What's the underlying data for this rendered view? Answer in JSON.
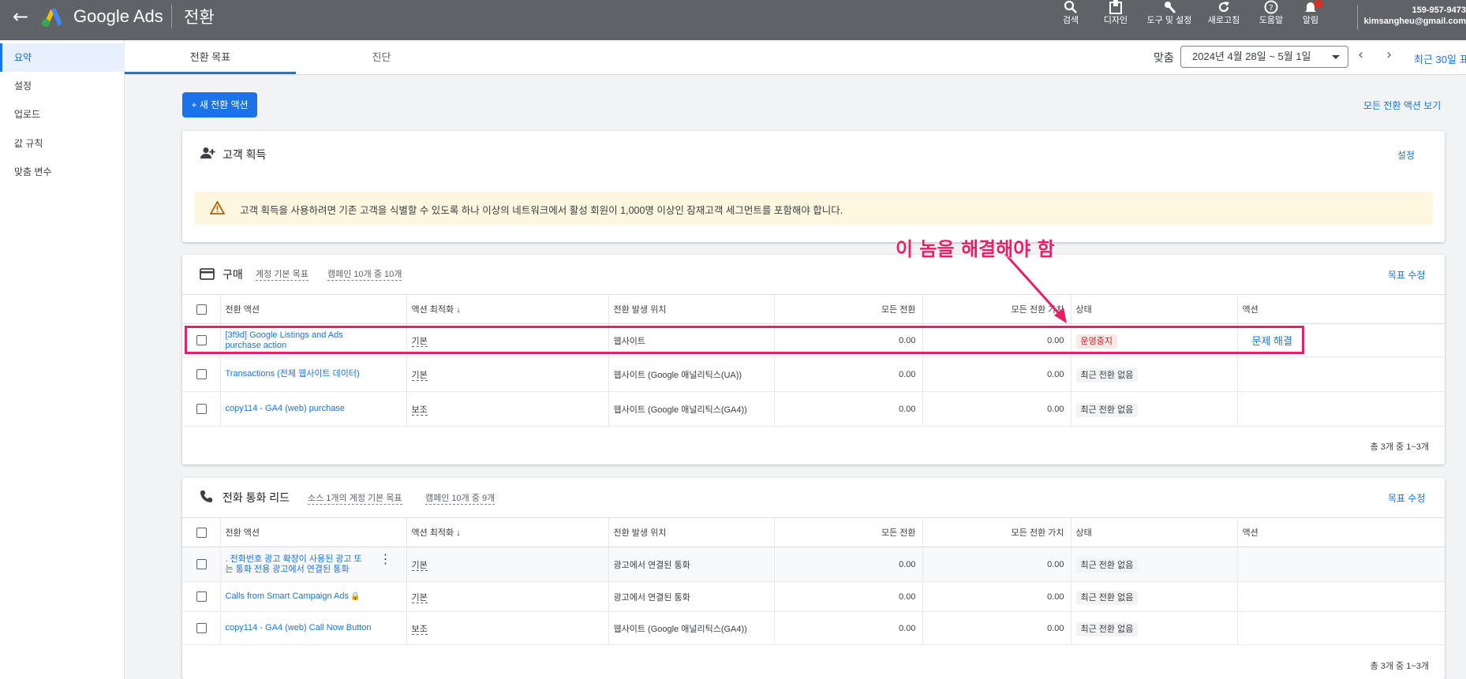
{
  "topbar": {
    "brand": "Google Ads",
    "page_title": "전환",
    "tools": [
      {
        "label": "검색",
        "icon": "search-icon"
      },
      {
        "label": "디자인",
        "icon": "design-icon"
      },
      {
        "label": "도구 및 설정",
        "icon": "wrench-icon"
      },
      {
        "label": "새로고침",
        "icon": "refresh-icon"
      },
      {
        "label": "도움말",
        "icon": "help-icon"
      },
      {
        "label": "알림",
        "icon": "bell-icon"
      }
    ],
    "account_id": "159-957-9473",
    "account_email": "kimsangheu@gmail.com"
  },
  "tabs": {
    "summary": "전환 목표",
    "diagnostics": "진단"
  },
  "date": {
    "label": "맞춤",
    "range": "2024년 4월 28일 ~ 5월 1일",
    "recent": "최근 30일 표"
  },
  "sidebar": {
    "items": [
      {
        "label": "요약",
        "active": true
      },
      {
        "label": "설정"
      },
      {
        "label": "업로드"
      },
      {
        "label": "값 규칙"
      },
      {
        "label": "맞춤 변수"
      }
    ]
  },
  "main": {
    "new_action": "+ 새 전환 액션",
    "view_all": "모든 전환 액션 보기"
  },
  "acquisition": {
    "title": "고객 획득",
    "settings": "설정",
    "warning": "고객 획득을 사용하려면 기존 고객을 식별할 수 있도록 하나 이상의 네트워크에서 활성 회원이 1,000명 이상인 잠재고객 세그먼트를 포함해야 합니다."
  },
  "columns": {
    "action": "전환 액션",
    "optimization": "액션 최적화",
    "source": "전환 발생 위치",
    "all_conv": "모든 전환",
    "all_value": "모든 전환 가치",
    "status": "상태",
    "actions": "액션"
  },
  "purchase": {
    "title": "구매",
    "tag1": "계정 기본 목표",
    "tag2": "캠페인 10개 중 10개",
    "edit": "목표 수정",
    "rows": [
      {
        "name_l1": "[3f9d] Google Listings and Ads",
        "name_l2": "purchase action",
        "opt": "기본",
        "source": "웹사이트",
        "conv": "0.00",
        "value": "0.00",
        "status": "운영중지",
        "action": "문제 해결"
      },
      {
        "name_l1": "Transactions (전체 웹사이트 데이터)",
        "opt": "기본",
        "source": "웹사이트 (Google 애널리틱스(UA))",
        "conv": "0.00",
        "value": "0.00",
        "status": "최근 전환 없음"
      },
      {
        "name_l1": "copy114 - GA4 (web) purchase",
        "opt": "보조",
        "source": "웹사이트 (Google 애널리틱스(GA4))",
        "conv": "0.00",
        "value": "0.00",
        "status": "최근 전환 없음"
      }
    ],
    "footer": "총 3개 중 1~3개"
  },
  "calls": {
    "title": "전화 통화 리드",
    "tag1": "소스 1개의 계정 기본 목표",
    "tag2": "캠페인 10개 중 9개",
    "edit": "목표 수정",
    "rows": [
      {
        "name_l1": ". 전화번호 광고 확장이 사용된 광고 또",
        "name_l2": "는 통화 전용 광고에서 연결된 통화",
        "opt": "기본",
        "source": "광고에서 연결된 통화",
        "conv": "0.00",
        "value": "0.00",
        "status": "최근 전환 없음"
      },
      {
        "name_l1": "Calls from Smart Campaign Ads",
        "opt": "기본",
        "source": "광고에서 연결된 통화",
        "conv": "0.00",
        "value": "0.00",
        "status": "최근 전환 없음"
      },
      {
        "name_l1": "copy114 - GA4 (web) Call Now Button",
        "opt": "보조",
        "source": "웹사이트 (Google 애널리틱스(GA4))",
        "conv": "0.00",
        "value": "0.00",
        "status": "최근 전환 없음"
      }
    ],
    "footer": "총 3개 중 1~3개"
  },
  "annotation": {
    "text": "이 놈을 해결해야 함",
    "color": "#e91e63"
  }
}
